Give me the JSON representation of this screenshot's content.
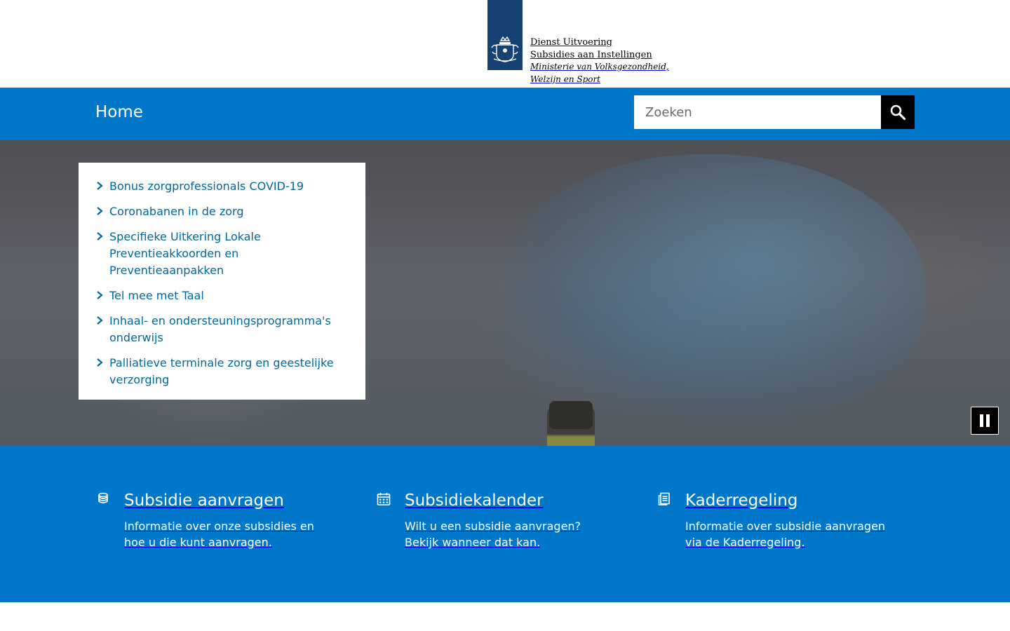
{
  "header": {
    "logo": {
      "line1": "Dienst Uitvoering",
      "line2": "Subsidies aan Instellingen",
      "line3": "Ministerie van Volksgezondheid,",
      "line4": "Welzijn en Sport",
      "emblem_icon": "rijksoverheid-emblem-icon",
      "block_color": "#154273"
    }
  },
  "nav": {
    "home_label": "Home",
    "background_color": "#0077c8"
  },
  "search": {
    "placeholder": "Zoeken",
    "button_icon": "search-icon"
  },
  "hero": {
    "topics": [
      {
        "label": "Bonus zorgprofessionals COVID-19"
      },
      {
        "label": "Coronabanen in de zorg"
      },
      {
        "label": "Specifieke Uitkering Lokale Preventieakkoorden en Preventieaanpakken"
      },
      {
        "label": "Tel mee met Taal"
      },
      {
        "label": "Inhaal- en ondersteuningsprogramma's onderwijs"
      },
      {
        "label": "Palliatieve terminale zorg en geestelijke verzorging"
      }
    ],
    "link_color": "#01689b",
    "pause_icon": "pause-icon"
  },
  "features": [
    {
      "icon": "coins-icon",
      "title": "Subsidie aanvragen",
      "text": "Informatie over onze subsidies en hoe u die kunt aanvragen."
    },
    {
      "icon": "calendar-icon",
      "title": "Subsidiekalender",
      "text": "Wilt u een subsidie aanvragen? Bekijk wanneer dat kan."
    },
    {
      "icon": "document-icon",
      "title": "Kaderregeling",
      "text": "Informatie over subsidie aanvragen via de Kaderregeling."
    }
  ]
}
